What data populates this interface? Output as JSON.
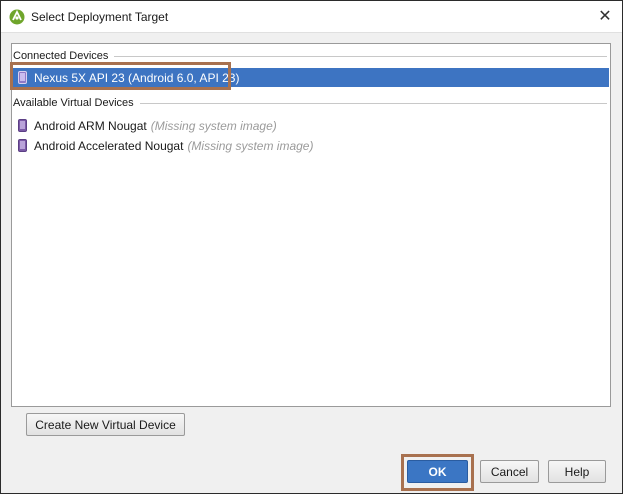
{
  "window": {
    "title": "Select Deployment Target",
    "close_glyph": "✕"
  },
  "connected": {
    "header": "Connected Devices",
    "devices": [
      {
        "name": "Nexus 5X API 23 (Android 6.0, API 23)",
        "status": "",
        "icon": "phone-icon",
        "selected": true
      }
    ]
  },
  "available": {
    "header": "Available Virtual Devices",
    "devices": [
      {
        "name": "Android ARM Nougat",
        "status": "(Missing system image)",
        "icon": "phone-icon",
        "selected": false
      },
      {
        "name": "Android Accelerated Nougat",
        "status": "(Missing system image)",
        "icon": "phone-icon",
        "selected": false
      }
    ]
  },
  "buttons": {
    "create": "Create New Virtual Device",
    "ok": "OK",
    "cancel": "Cancel",
    "help": "Help"
  },
  "colors": {
    "selection": "#3d74c2",
    "annotation_box": "#a8714f",
    "android_green": "#6fa52b",
    "phone_purple": "#7b5aa6"
  }
}
